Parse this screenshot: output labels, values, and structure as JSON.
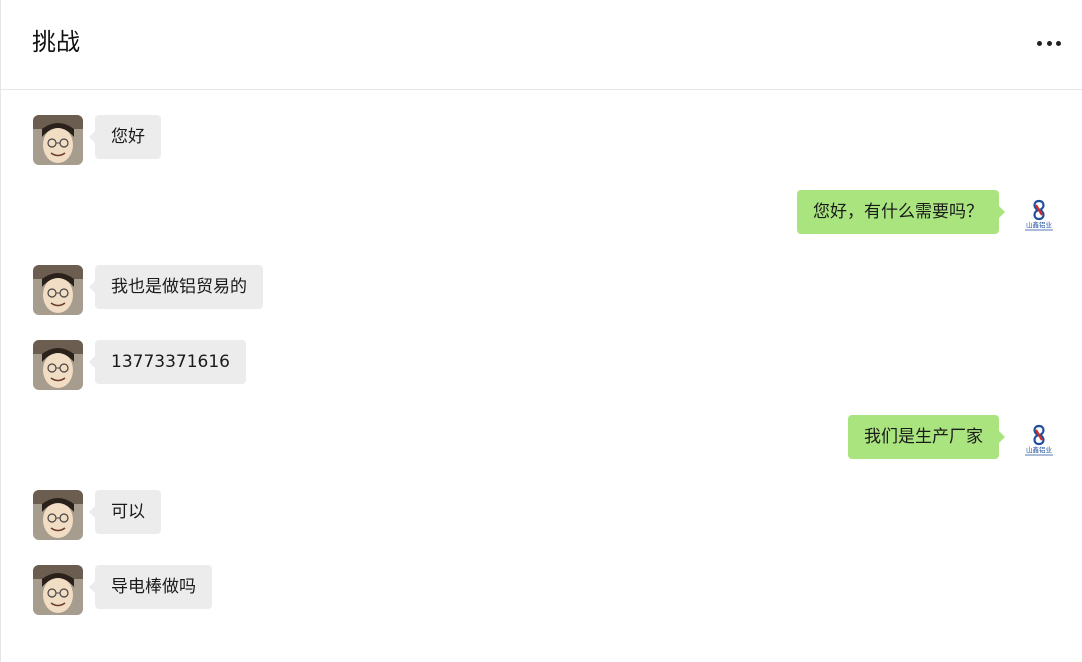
{
  "header": {
    "title": "挑战"
  },
  "brand": {
    "logo_text": "山鑫铝业"
  },
  "messages": [
    {
      "side": "left",
      "text": "您好"
    },
    {
      "side": "right",
      "text": "您好，有什么需要吗？"
    },
    {
      "side": "left",
      "text": "我也是做铝贸易的"
    },
    {
      "side": "left",
      "text": "13773371616"
    },
    {
      "side": "right",
      "text": "我们是生产厂家"
    },
    {
      "side": "left",
      "text": "可以"
    },
    {
      "side": "left",
      "text": "导电棒做吗"
    }
  ],
  "colors": {
    "sent_bubble": "#a9e47f",
    "received_bubble": "#ececec",
    "logo_blue": "#1f4e9c",
    "logo_red": "#d12b2b"
  }
}
